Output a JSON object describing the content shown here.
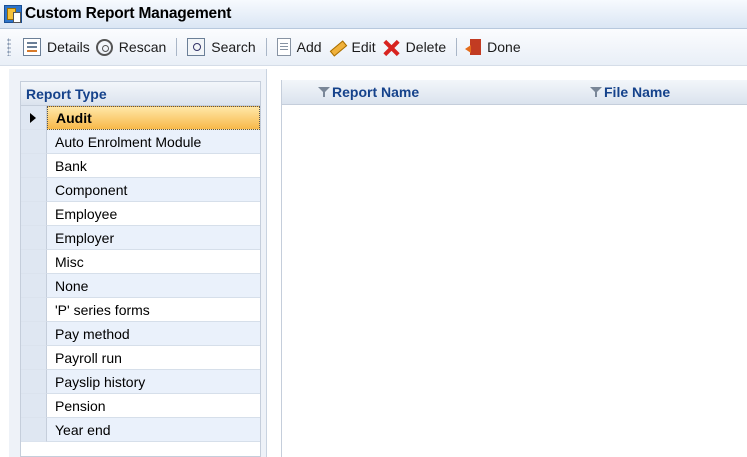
{
  "window": {
    "title": "Custom Report Management"
  },
  "toolbar": {
    "details": "Details",
    "rescan": "Rescan",
    "search": "Search",
    "add": "Add",
    "edit": "Edit",
    "delete": "Delete",
    "done": "Done"
  },
  "report_types": {
    "header": "Report Type",
    "selected_index": 0,
    "items": [
      "Audit",
      "Auto Enrolment Module",
      "Bank",
      "Component",
      "Employee",
      "Employer",
      "Misc",
      "None",
      "'P' series forms",
      "Pay method",
      "Payroll run",
      "Payslip history",
      "Pension",
      "Year end"
    ]
  },
  "reports_grid": {
    "columns": [
      "Report Name",
      "File Name"
    ],
    "rows": []
  },
  "colors": {
    "selection": "#f8b94a",
    "header_text": "#15428b",
    "alt_row": "#eaf1fb"
  }
}
